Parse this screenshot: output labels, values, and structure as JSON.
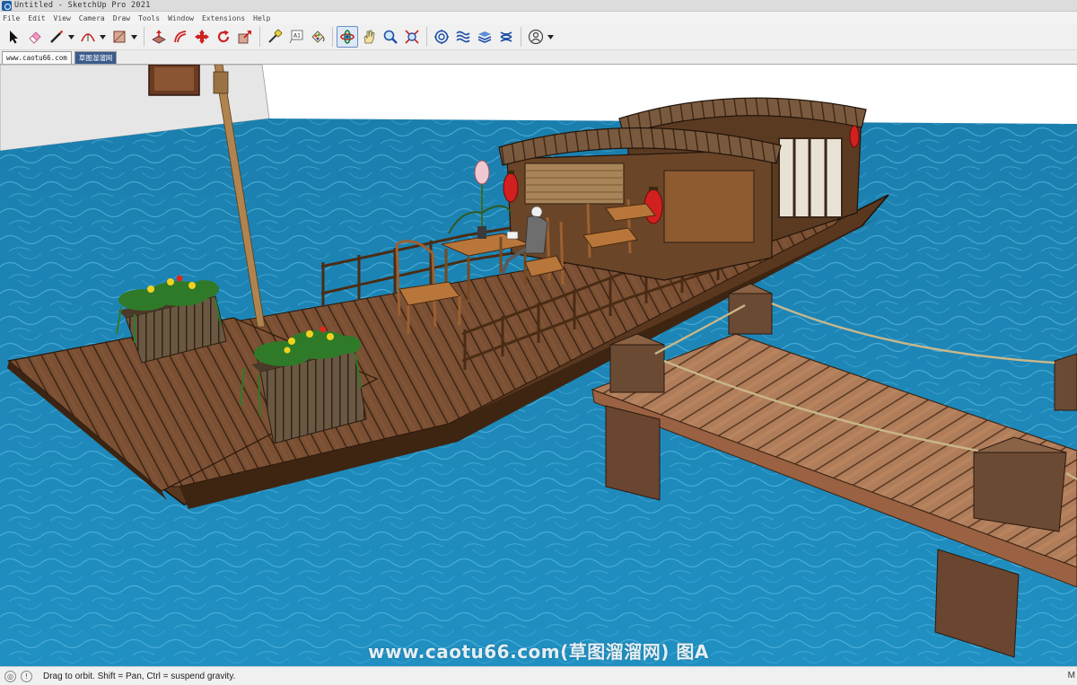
{
  "window": {
    "title": "Untitled - SketchUp Pro 2021"
  },
  "menu": [
    "File",
    "Edit",
    "View",
    "Camera",
    "Draw",
    "Tools",
    "Window",
    "Extensions",
    "Help"
  ],
  "toolbar": {
    "tools": [
      {
        "name": "select-icon"
      },
      {
        "name": "eraser-icon"
      },
      {
        "name": "line-icon",
        "dropdown": true
      },
      {
        "name": "arc-icon",
        "dropdown": true
      },
      {
        "name": "rectangle-icon",
        "dropdown": true
      },
      {
        "name": "push-pull-icon"
      },
      {
        "name": "offset-icon"
      },
      {
        "name": "move-icon"
      },
      {
        "name": "rotate-icon"
      },
      {
        "name": "scale-icon"
      },
      {
        "name": "tape-measure-icon"
      },
      {
        "name": "text-icon"
      },
      {
        "name": "paint-bucket-icon"
      },
      {
        "name": "orbit-icon",
        "active": true
      },
      {
        "name": "pan-icon"
      },
      {
        "name": "zoom-icon"
      },
      {
        "name": "zoom-extents-icon"
      },
      {
        "name": "warehouse-icon"
      },
      {
        "name": "extension-warehouse-icon"
      },
      {
        "name": "layout-icon"
      },
      {
        "name": "extension-manager-icon"
      },
      {
        "name": "account-icon",
        "dropdown": true
      }
    ],
    "text_tool_label": "A1"
  },
  "scene_tabs": [
    "www.caotu66.com",
    "草图溜溜网"
  ],
  "watermark": "www.caotu66.com(草图溜溜网) 图A",
  "status": {
    "message": "Drag to orbit. Shift = Pan, Ctrl = suspend gravity.",
    "measurements_label": "M"
  },
  "colors": {
    "water": "#1d86b5",
    "sky": "#ffffff",
    "wall": "#e7e7e7",
    "wood": "#8a5a36",
    "lantern": "#d21f1f",
    "active_tool": "#dde8f7"
  }
}
